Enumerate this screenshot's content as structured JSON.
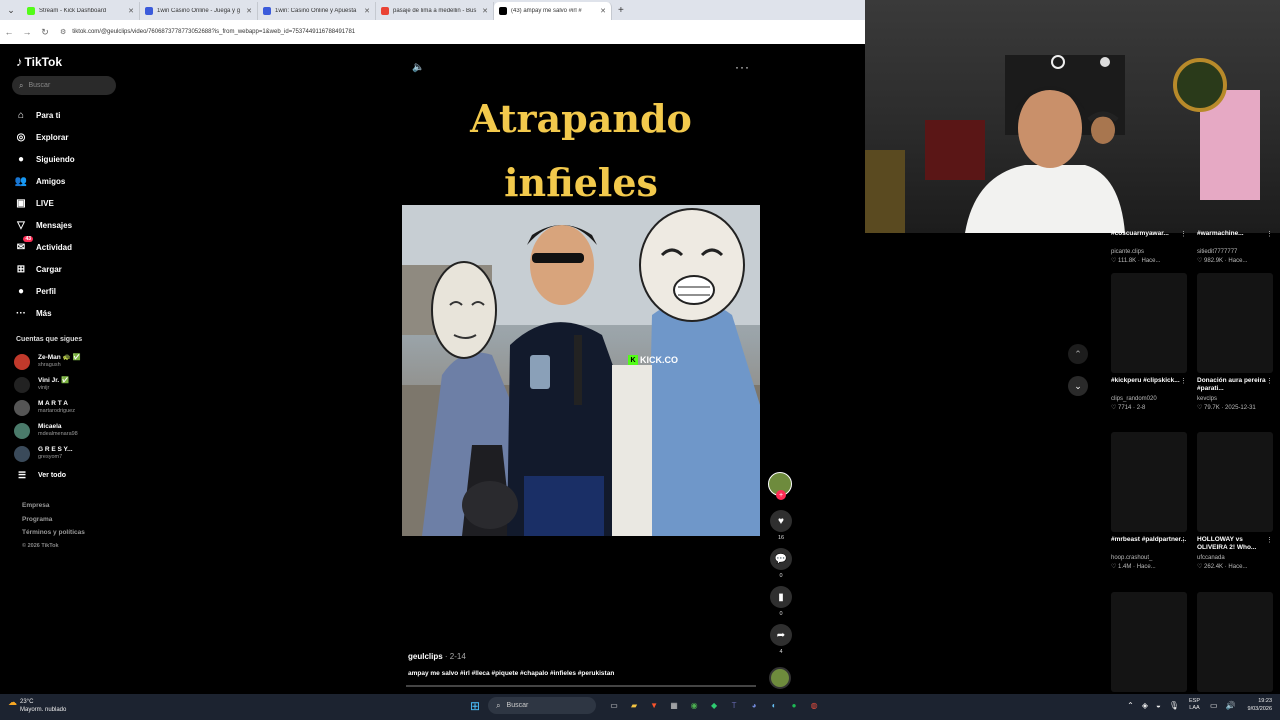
{
  "browser": {
    "tabs": [
      {
        "title": "Stream - Kick Dashboard",
        "favicon_color": "#53fc18"
      },
      {
        "title": "1win Casino Online - Juega y g",
        "favicon_color": "#3b5bdb"
      },
      {
        "title": "1win: Casino Online y Apuesta",
        "favicon_color": "#3b5bdb"
      },
      {
        "title": "pasaje de lima a medellin - Bus",
        "favicon_color": "#ea4335"
      },
      {
        "title": "(43) ampay me salvo #irl #",
        "favicon_color": "#000000"
      }
    ],
    "url": "tiktok.com/@geulclips/video/7606873778773052688?is_from_webapp=1&web_id=7537449116788491781"
  },
  "tiktok": {
    "logo": "TikTok",
    "search_placeholder": "Buscar",
    "nav": [
      {
        "label": "Para ti",
        "icon": "home-icon",
        "glyph": "⌂"
      },
      {
        "label": "Explorar",
        "icon": "compass-icon",
        "glyph": "◎"
      },
      {
        "label": "Siguiendo",
        "icon": "following-icon",
        "glyph": "●"
      },
      {
        "label": "Amigos",
        "icon": "friends-icon",
        "glyph": "👥"
      },
      {
        "label": "LIVE",
        "icon": "live-icon",
        "glyph": "▣"
      },
      {
        "label": "Mensajes",
        "icon": "messages-icon",
        "glyph": "▽"
      },
      {
        "label": "Actividad",
        "icon": "activity-icon",
        "glyph": "✉",
        "badge": "43"
      },
      {
        "label": "Cargar",
        "icon": "upload-icon",
        "glyph": "⊞"
      },
      {
        "label": "Perfil",
        "icon": "profile-icon",
        "glyph": "●"
      },
      {
        "label": "Más",
        "icon": "more-icon",
        "glyph": "···"
      }
    ],
    "following_title": "Cuentas que sigues",
    "following": [
      {
        "name": "Ze-Man 🐢 ✅",
        "handle": "shragush",
        "color": "#c0392b"
      },
      {
        "name": "Vini Jr. ✅",
        "handle": "vinijr",
        "color": "#222222"
      },
      {
        "name": "M A R T A",
        "handle": "martarodriguez",
        "color": "#555555"
      },
      {
        "name": "Micaela",
        "handle": "mdealmenara98",
        "color": "#4a7a6a"
      },
      {
        "name": "G R E S Y...",
        "handle": "gresyom7",
        "color": "#3a4a5a"
      }
    ],
    "see_all": "Ver todo",
    "footer": [
      "Empresa",
      "Programa",
      "Términos y políticas"
    ],
    "copyright": "© 2026 TikTok"
  },
  "video": {
    "title_line1": "Atrapando",
    "title_line2": "infieles",
    "watermark": "KICK.CO",
    "author": "geulclips",
    "date": "· 2-14",
    "caption": "ampay me salvo #irl #lleca #piquete #chapalo #infieles #perukistan",
    "likes": "16",
    "comments": "0",
    "saves": "0",
    "shares": "4"
  },
  "grid": [
    {
      "title": "#coscuarmyawar...",
      "user": "picante.clips",
      "stat": "♡ 111.8K · Hace..."
    },
    {
      "title": "#warmachine...",
      "user": "sitiedit7777777",
      "stat": "♡ 982.9K · Hace..."
    },
    {
      "title": "#kickperu #clipskick...",
      "user": "clips_random020",
      "stat": "♡ 7714 · 2-8"
    },
    {
      "title": "Donación aura pereira #parati...",
      "user": "kevclps",
      "stat": "♡ 79.7K · 2025-12-31"
    },
    {
      "title": "#mrbeast #paldpartner...",
      "user": "hoop.crashout_",
      "stat": "♡ 1.4M · Hace..."
    },
    {
      "title": "HOLLOWAY vs OLIVEIRA 2! Who...",
      "user": "ufccanada",
      "stat": "♡ 262.4K · Hace..."
    }
  ],
  "taskbar": {
    "weather_temp": "23°C",
    "weather_desc": "Mayorm. nublado",
    "search": "Buscar",
    "lang1": "ESP",
    "lang2": "LAA",
    "time": "19:23",
    "date": "9/03/2026"
  },
  "colors": {
    "accent": "#fe2c55",
    "title_yellow": "#f2c94c",
    "kick_green": "#53fc18"
  }
}
